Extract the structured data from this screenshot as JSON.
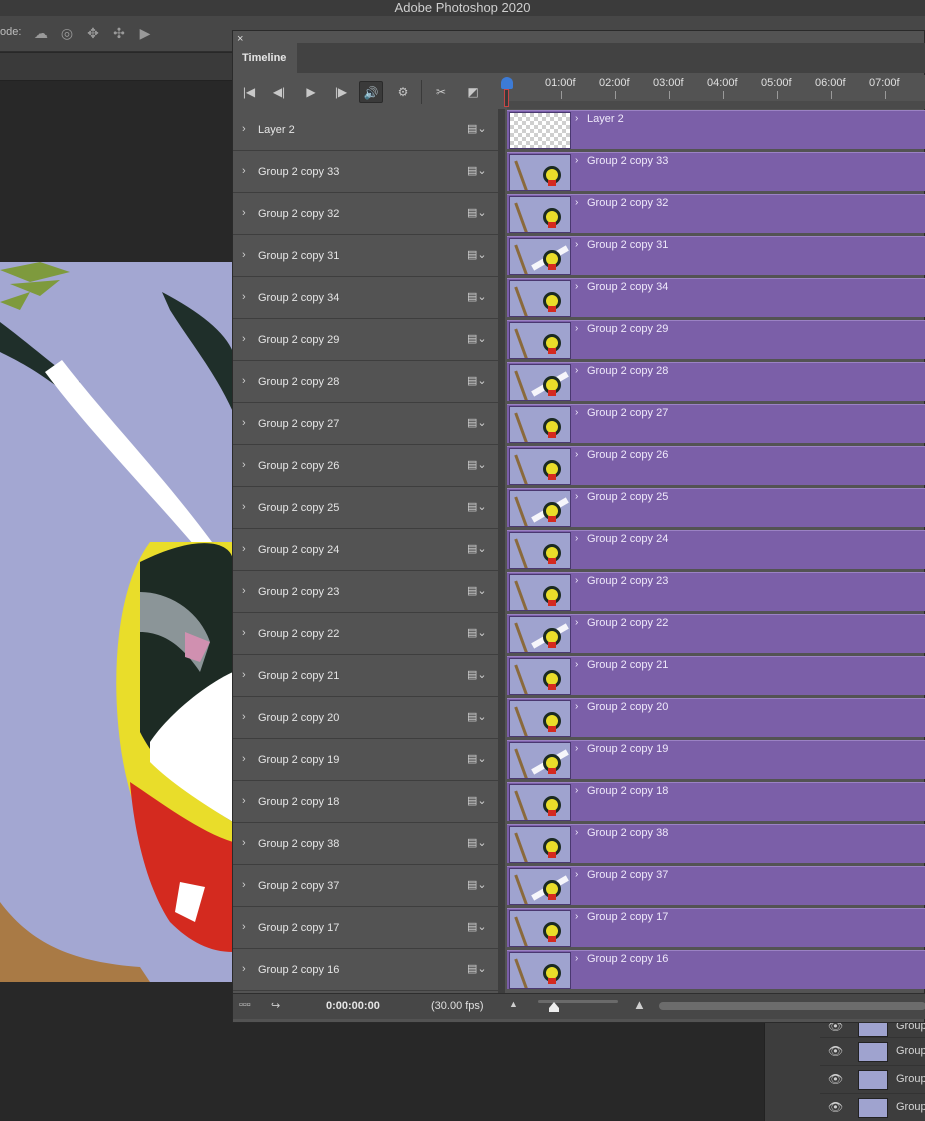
{
  "app": {
    "title": "Adobe Photoshop 2020"
  },
  "options_bar": {
    "mode_label": "ode:",
    "icons": [
      "orbit-icon",
      "roll-icon",
      "pan-icon",
      "slide-icon",
      "video-camera-icon"
    ]
  },
  "timeline": {
    "tab_label": "Timeline",
    "controls": [
      "go-to-first-frame-icon",
      "previous-frame-icon",
      "play-icon",
      "next-frame-icon",
      "audio-icon",
      "settings-icon",
      "split-icon",
      "transition-icon"
    ],
    "ruler": [
      "01:00f",
      "02:00f",
      "03:00f",
      "04:00f",
      "05:00f",
      "06:00f",
      "07:00f"
    ],
    "tracks": [
      {
        "name": "Layer 2",
        "clip": "Layer 2",
        "thumb": "transparent"
      },
      {
        "name": "Group 2 copy 33",
        "clip": "Group 2 copy 33"
      },
      {
        "name": "Group 2 copy 32",
        "clip": "Group 2 copy 32"
      },
      {
        "name": "Group 2 copy 31",
        "clip": "Group 2 copy 31"
      },
      {
        "name": "Group 2 copy 34",
        "clip": "Group 2 copy 34"
      },
      {
        "name": "Group 2 copy 29",
        "clip": "Group 2 copy 29"
      },
      {
        "name": "Group 2 copy 28",
        "clip": "Group 2 copy 28"
      },
      {
        "name": "Group 2 copy 27",
        "clip": "Group 2 copy 27"
      },
      {
        "name": "Group 2 copy 26",
        "clip": "Group 2 copy 26"
      },
      {
        "name": "Group 2 copy 25",
        "clip": "Group 2 copy 25"
      },
      {
        "name": "Group 2 copy 24",
        "clip": "Group 2 copy 24"
      },
      {
        "name": "Group 2 copy 23",
        "clip": "Group 2 copy 23"
      },
      {
        "name": "Group 2 copy 22",
        "clip": "Group 2 copy 22"
      },
      {
        "name": "Group 2 copy 21",
        "clip": "Group 2 copy 21"
      },
      {
        "name": "Group 2 copy 20",
        "clip": "Group 2 copy 20"
      },
      {
        "name": "Group 2 copy 19",
        "clip": "Group 2 copy 19"
      },
      {
        "name": "Group 2 copy 18",
        "clip": "Group 2 copy 18"
      },
      {
        "name": "Group 2 copy 38",
        "clip": "Group 2 copy 38"
      },
      {
        "name": "Group 2 copy 37",
        "clip": "Group 2 copy 37"
      },
      {
        "name": "Group 2 copy 17",
        "clip": "Group 2 copy 17"
      },
      {
        "name": "Group 2 copy 16",
        "clip": "Group 2 copy 16"
      }
    ],
    "footer": {
      "timecode": "0:00:00:00",
      "fps": "(30.00 fps)"
    },
    "colors": {
      "clip": "#7b5fa8",
      "playhead": "#3d7bd6",
      "panel": "#535353"
    }
  },
  "layers_panel": {
    "items": [
      {
        "name": "Group"
      },
      {
        "name": "Group"
      },
      {
        "name": "Group"
      },
      {
        "name": "Group"
      }
    ]
  }
}
